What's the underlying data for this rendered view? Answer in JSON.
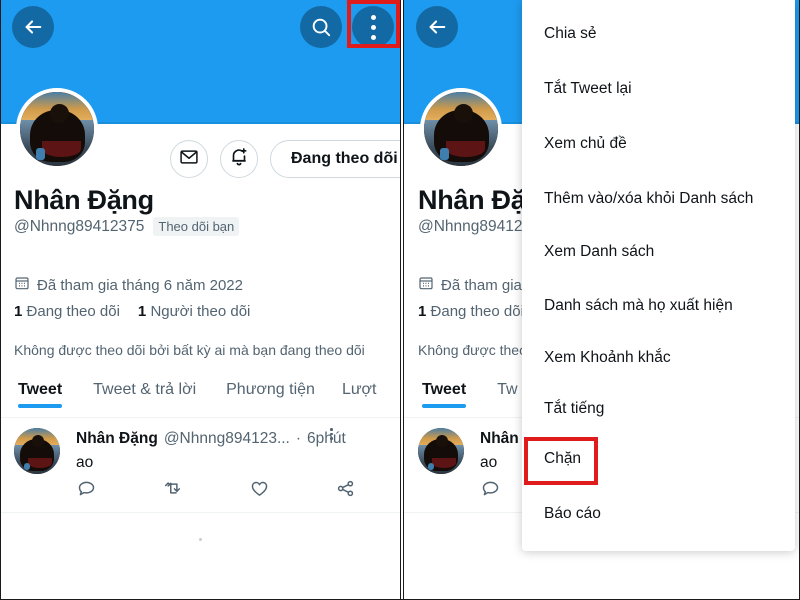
{
  "app": "Twitter mobile — profile screen with overflow menu",
  "colors": {
    "brand_blue": "#1d9bf0",
    "highlight_red": "#e01b1b",
    "text_primary": "#0f1419",
    "text_secondary": "#536471",
    "border": "#cfd9de"
  },
  "profile": {
    "display_name": "Nhân Đặng",
    "handle": "@Nhnng89412375",
    "follows_you_badge": "Theo dõi bạn",
    "joined": "Đã tham gia tháng 6 năm 2022",
    "following_count": "1",
    "following_label": "Đang theo dõi",
    "followers_count": "1",
    "followers_label": "Người theo dõi",
    "not_followed_note": "Không được theo dõi bởi bất kỳ ai mà bạn đang theo dõi",
    "follow_button": "Đang theo dõi",
    "message_icon": "mail-icon",
    "notify_icon": "bell-plus-icon",
    "calendar_icon": "calendar-icon",
    "back_icon": "back-arrow-icon",
    "search_icon": "search-icon",
    "overflow_icon": "three-dots-vertical-icon"
  },
  "tabs": [
    {
      "label": "Tweet",
      "active": true
    },
    {
      "label": "Tweet & trả lời",
      "active": false
    },
    {
      "label": "Phương tiện",
      "active": false
    },
    {
      "label": "Lượt",
      "active": false
    }
  ],
  "tabs_right": [
    {
      "label": "Tweet",
      "active": true
    },
    {
      "label": "Tw",
      "active": false
    }
  ],
  "tweet": {
    "author": "Nhân Đặng",
    "handle": "@Nhnng894123...",
    "separator": "·",
    "time": "6phút",
    "text": "ao",
    "overflow_icon": "three-dots-vertical-icon",
    "actions": [
      {
        "name": "reply-icon",
        "label": "reply"
      },
      {
        "name": "retweet-icon",
        "label": "retweet"
      },
      {
        "name": "like-icon",
        "label": "like"
      },
      {
        "name": "share-icon",
        "label": "share"
      }
    ]
  },
  "menu": {
    "items": [
      {
        "label": "Chia sẻ",
        "highlighted": false
      },
      {
        "label": "Tắt Tweet lại",
        "highlighted": false
      },
      {
        "label": "Xem chủ đề",
        "highlighted": false
      },
      {
        "label": "Thêm vào/xóa khỏi Danh sách",
        "highlighted": false
      },
      {
        "label": "Xem Danh sách",
        "highlighted": false
      },
      {
        "label": "Danh sách mà họ xuất hiện",
        "highlighted": false
      },
      {
        "label": "Xem Khoảnh khắc",
        "highlighted": false
      },
      {
        "label": "Tắt tiếng",
        "highlighted": false
      },
      {
        "label": "Chặn",
        "highlighted": true
      },
      {
        "label": "Báo cáo",
        "highlighted": false
      }
    ]
  }
}
